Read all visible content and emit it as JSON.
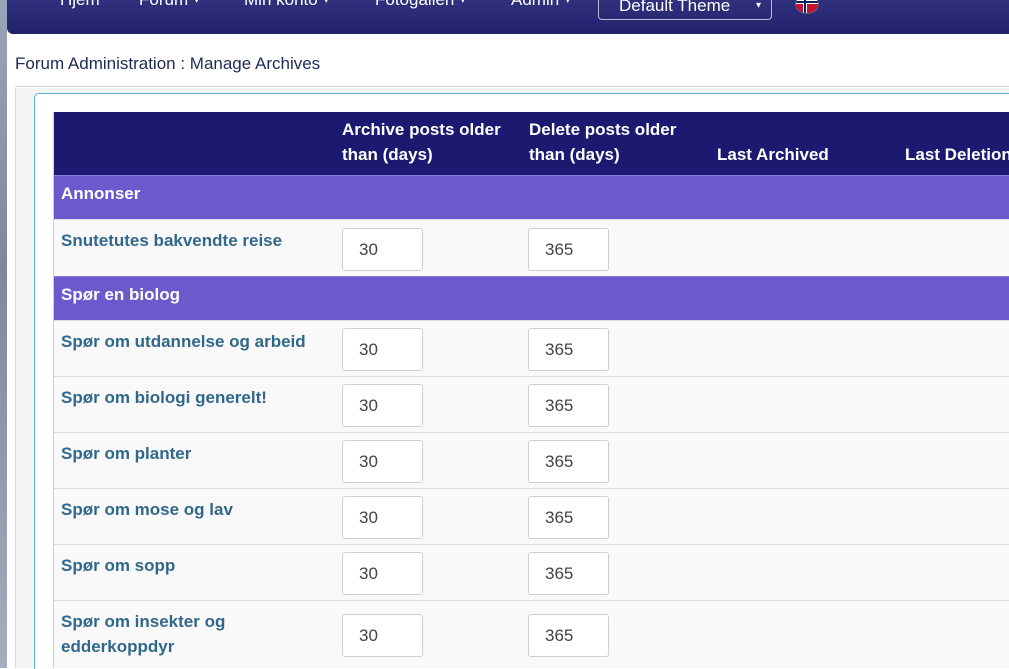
{
  "nav": {
    "items": [
      {
        "label": "Hjem",
        "has_caret": false
      },
      {
        "label": "Forum",
        "has_caret": true
      },
      {
        "label": "Min konto",
        "has_caret": true
      },
      {
        "label": "Fotogalleri",
        "has_caret": true
      },
      {
        "label": "Admin",
        "has_caret": true
      }
    ],
    "theme_select": "Default Theme",
    "caret_glyph": "▾",
    "language_flag_icon": "norway-flag-icon"
  },
  "breadcrumb": "Forum Administration : Manage Archives",
  "table": {
    "headers": {
      "archive_line1": "Archive posts older",
      "archive_line2": "than (days)",
      "delete_line1": "Delete posts older",
      "delete_line2": "than (days)",
      "last_archived": "Last Archived",
      "last_deletion": "Last Deletion"
    },
    "categories": [
      {
        "name": "Annonser",
        "forums": [
          {
            "name": "Snutetutes bakvendte reise",
            "archive": "30",
            "delete": "365"
          }
        ]
      },
      {
        "name": "Spør en biolog",
        "forums": [
          {
            "name": "Spør om utdannelse og arbeid",
            "archive": "30",
            "delete": "365"
          },
          {
            "name": "Spør om biologi generelt!",
            "archive": "30",
            "delete": "365"
          },
          {
            "name": "Spør om planter",
            "archive": "30",
            "delete": "365"
          },
          {
            "name": "Spør om mose og lav",
            "archive": "30",
            "delete": "365"
          },
          {
            "name": "Spør om sopp",
            "archive": "30",
            "delete": "365"
          },
          {
            "name": "Spør om insekter og",
            "name_line2": "edderkoppdyr",
            "archive": "30",
            "delete": "365"
          }
        ]
      }
    ]
  },
  "colors": {
    "navbar": "#22226b",
    "table_header": "#1c1a70",
    "category_row": "#6c5acd",
    "forum_link": "#31688a"
  }
}
